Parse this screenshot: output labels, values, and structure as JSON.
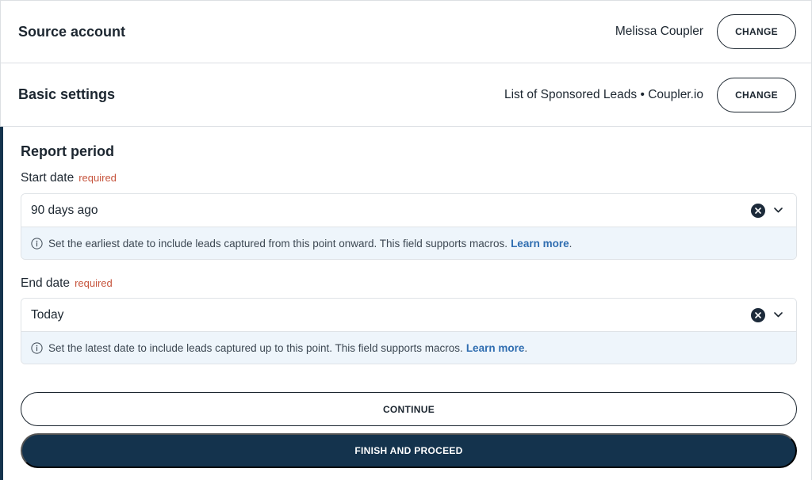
{
  "source_account": {
    "title": "Source account",
    "value": "Melissa Coupler",
    "change_label": "CHANGE"
  },
  "basic_settings": {
    "title": "Basic settings",
    "value": "List of Sponsored Leads • Coupler.io",
    "change_label": "CHANGE"
  },
  "report_period": {
    "title": "Report period",
    "start_date": {
      "label": "Start date",
      "required_label": "required",
      "value": "90 days ago",
      "hint": "Set the earliest date to include leads captured from this point onward. This field supports macros.",
      "link": "Learn more",
      "link_suffix": "."
    },
    "end_date": {
      "label": "End date",
      "required_label": "required",
      "value": "Today",
      "hint": "Set the latest date to include leads captured up to this point. This field supports macros.",
      "link": "Learn more",
      "link_suffix": "."
    }
  },
  "actions": {
    "continue_label": "CONTINUE",
    "finish_label": "FINISH AND PROCEED"
  },
  "colors": {
    "accent": "#14334d",
    "required": "#c6543d",
    "link": "#2f6db0",
    "hint_bg": "#eef5fb"
  },
  "icons": {
    "clear": "close-circle-icon",
    "dropdown": "chevron-down-icon",
    "info": "info-icon"
  }
}
